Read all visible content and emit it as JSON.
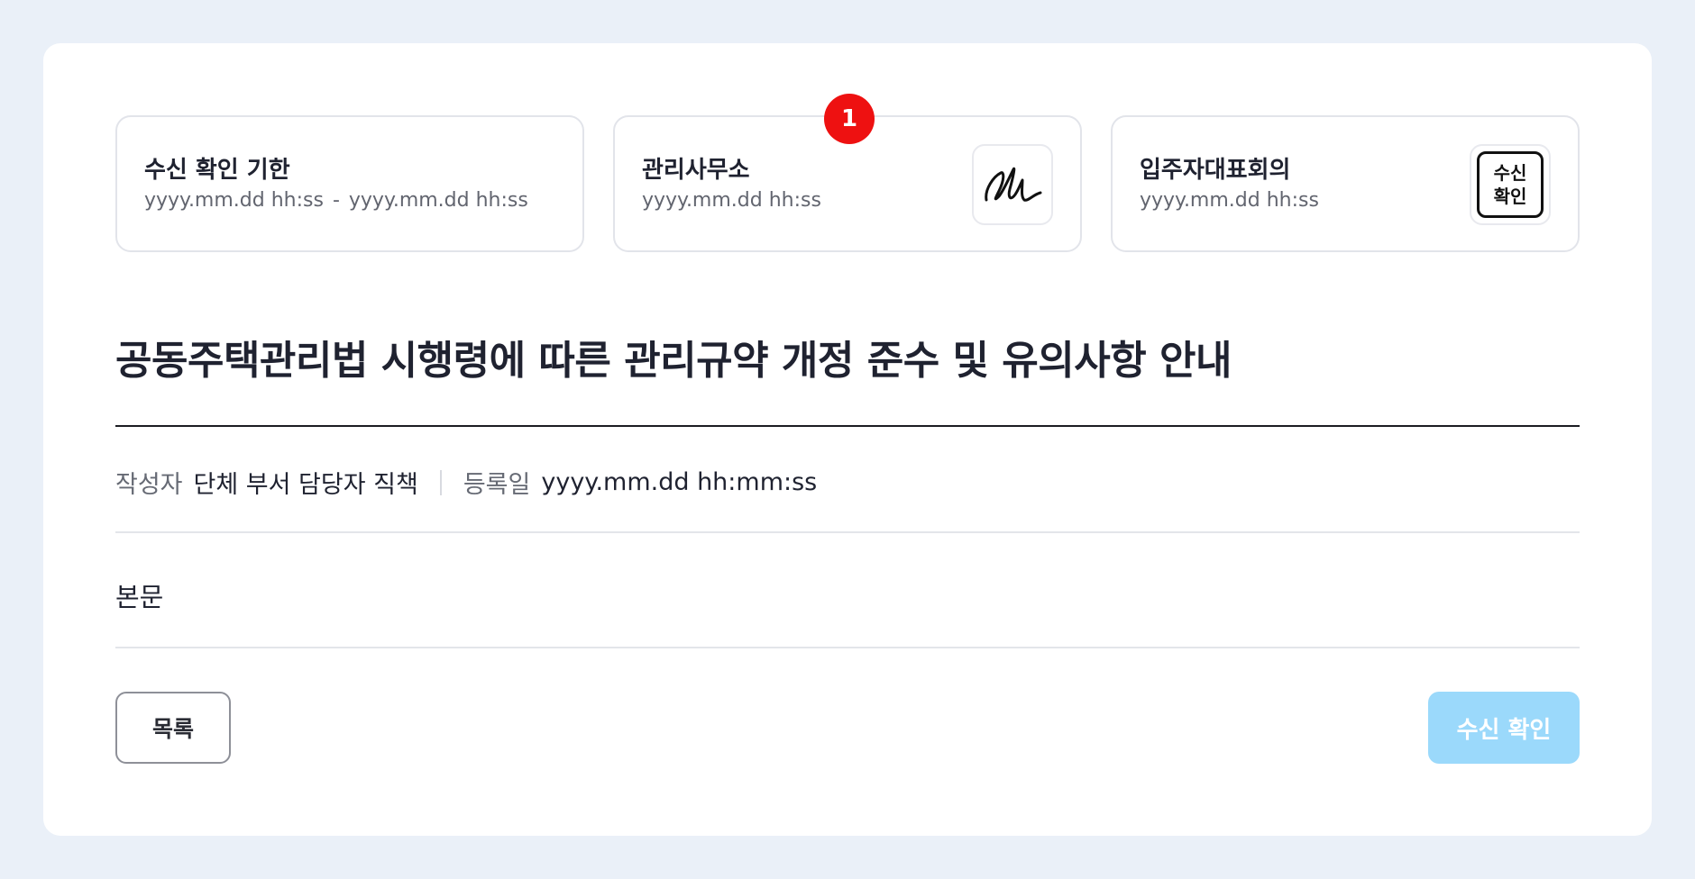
{
  "info_cards": [
    {
      "title": "수신 확인 기한",
      "date_start": "yyyy.mm.dd hh:ss",
      "date_separator": "-",
      "date_end": "yyyy.mm.dd hh:ss"
    },
    {
      "title": "관리사무소",
      "date": "yyyy.mm.dd hh:ss",
      "badge_count": "1",
      "stamp_icon": "signature-icon"
    },
    {
      "title": "입주자대표회의",
      "date": "yyyy.mm.dd hh:ss",
      "stamp_line1": "수신",
      "stamp_line2": "확인"
    }
  ],
  "document": {
    "title": "공동주택관리법 시행령에 따른 관리규약 개정 준수 및 유의사항 안내",
    "author_label": "작성자",
    "author_value": "단체 부서 담당자 직책",
    "date_label": "등록일",
    "date_value": "yyyy.mm.dd hh:mm:ss",
    "body": "본문"
  },
  "buttons": {
    "list_label": "목록",
    "confirm_label": "수신 확인"
  },
  "colors": {
    "page_background": "#eaf0f8",
    "badge": "#ee1111",
    "confirm_button": "#9bd9fb"
  }
}
